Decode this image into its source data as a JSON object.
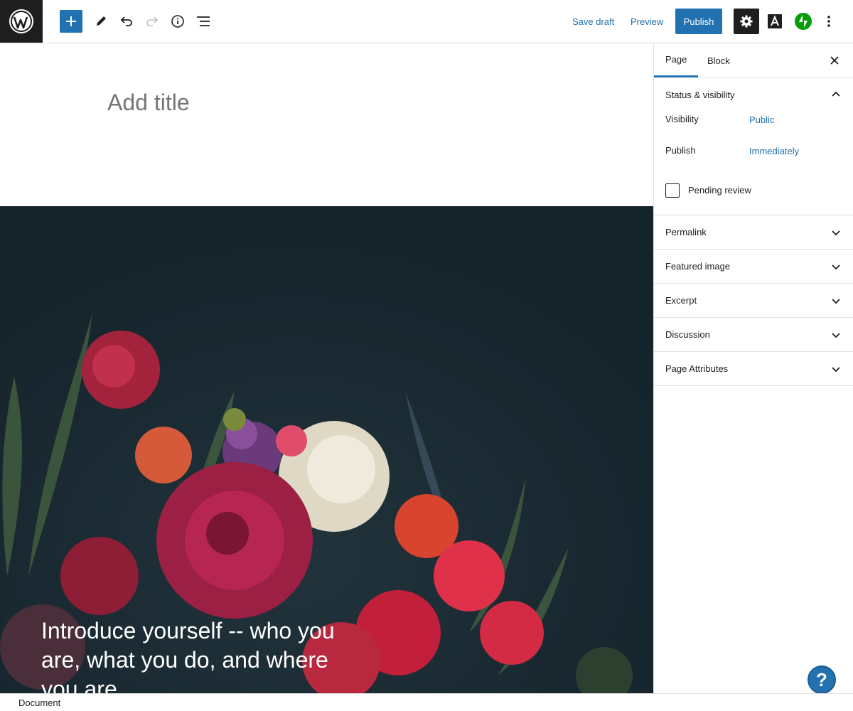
{
  "toolbar": {
    "save_draft": "Save draft",
    "preview": "Preview",
    "publish": "Publish"
  },
  "editor": {
    "title_placeholder": "Add title",
    "cover_text": "Introduce yourself -- who you are, what you do, and where you are"
  },
  "sidebar": {
    "tabs": [
      {
        "label": "Page",
        "active": true
      },
      {
        "label": "Block",
        "active": false
      }
    ],
    "status_visibility": {
      "heading": "Status & visibility",
      "expanded": true,
      "visibility_label": "Visibility",
      "visibility_value": "Public",
      "publish_label": "Publish",
      "publish_value": "Immediately",
      "pending_review_label": "Pending review",
      "pending_review_checked": false
    },
    "panels": [
      {
        "label": "Permalink"
      },
      {
        "label": "Featured image"
      },
      {
        "label": "Excerpt"
      },
      {
        "label": "Discussion"
      },
      {
        "label": "Page Attributes"
      }
    ]
  },
  "footer": {
    "breadcrumb": "Document"
  },
  "help": {
    "glyph": "?"
  },
  "colors": {
    "accent": "#2271b1",
    "dark": "#1e1e1e",
    "jetpack": "#069e08"
  }
}
